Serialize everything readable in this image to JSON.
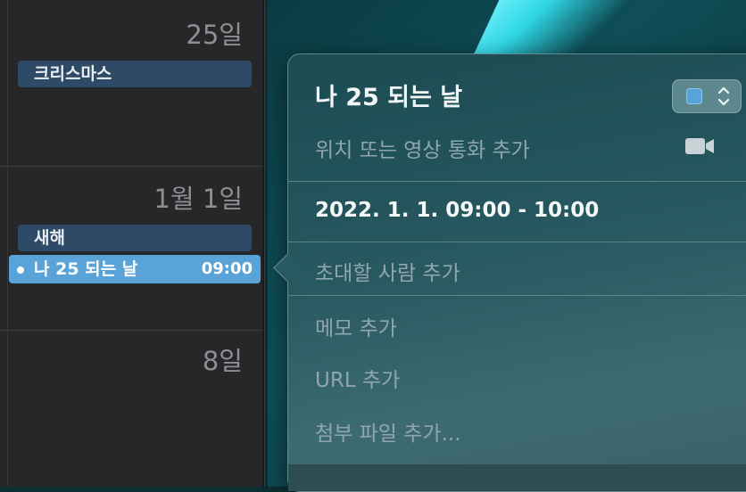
{
  "calendar": {
    "days": [
      {
        "label": "25일",
        "events": [
          "크리스마스"
        ]
      },
      {
        "label": "1월 1일",
        "events": [
          "새해"
        ]
      },
      {
        "label": "8일",
        "events": []
      }
    ],
    "selected_event": {
      "title": "나 25 되는 날",
      "time": "09:00"
    }
  },
  "popover": {
    "title": "나 25 되는 날",
    "calendar_color": "#5aa3d8",
    "location_placeholder": "위치 또는 영상 통화 추가",
    "date_range": "2022. 1. 1. 09:00 - 10:00",
    "invitees_placeholder": "초대할 사람 추가",
    "notes_placeholder": "메모 추가",
    "url_placeholder": "URL 추가",
    "attachment_placeholder": "첨부 파일 추가..."
  }
}
